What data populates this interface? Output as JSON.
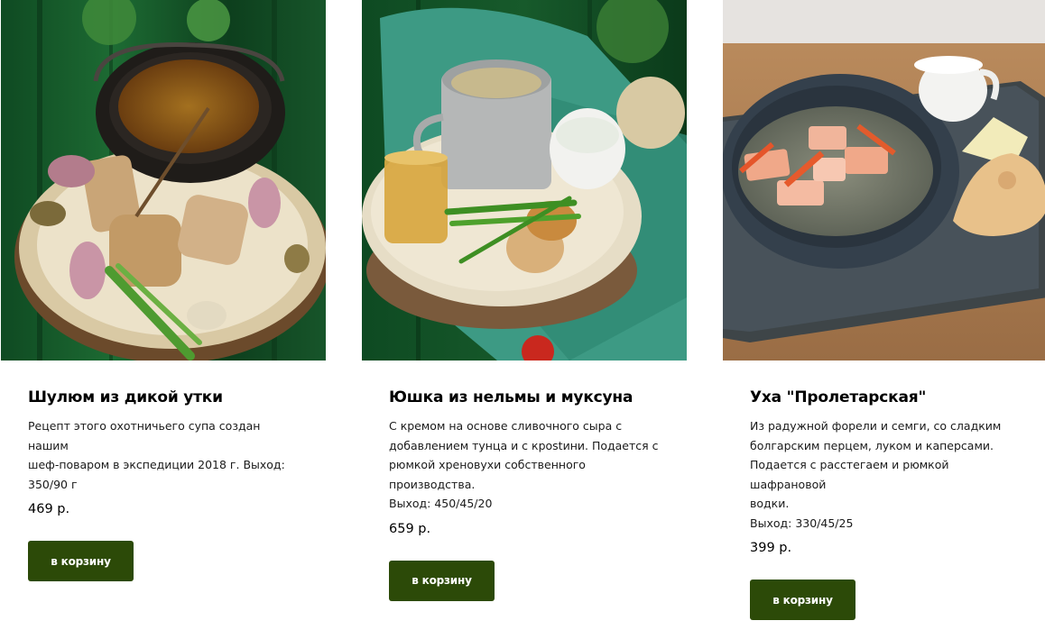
{
  "products": [
    {
      "image_label": "Шулюм из дикой утки — фото блюда",
      "title": "Шулюм из дикой утки",
      "description": "Рецепт этого охотничьего супа создан нашим\nшеф-поваром в экспедиции 2018 г. Выход:\n350/90 г",
      "price": "469 р.",
      "button_label": "в корзину"
    },
    {
      "image_label": "Юшка из нельмы и муксуна — фото блюда",
      "title": "Юшка из нельмы и муксуна",
      "description": "С кремом на основе сливочного сыра с\nдобавлением тунца и с крostини. Подается с\nрюмкой хреновухи собственного производства.\nВыход: 450/45/20",
      "price": "659 р.",
      "button_label": "в корзину"
    },
    {
      "image_label": "Уха \"Пролетарская\" — фото блюда",
      "title": "Уха \"Пролетарская\"",
      "description": "Из радужной форели и семги, со сладким\nболгарским перцем, луком и каперсами.\nПодается с расстегаем и рюмкой шафрановой\nводки.\nВыход: 330/45/25",
      "price": "399 р.",
      "button_label": "в корзину"
    }
  ],
  "colors": {
    "button_bg": "#2c4a08",
    "button_text": "#ffffff",
    "title_text": "#000000"
  }
}
